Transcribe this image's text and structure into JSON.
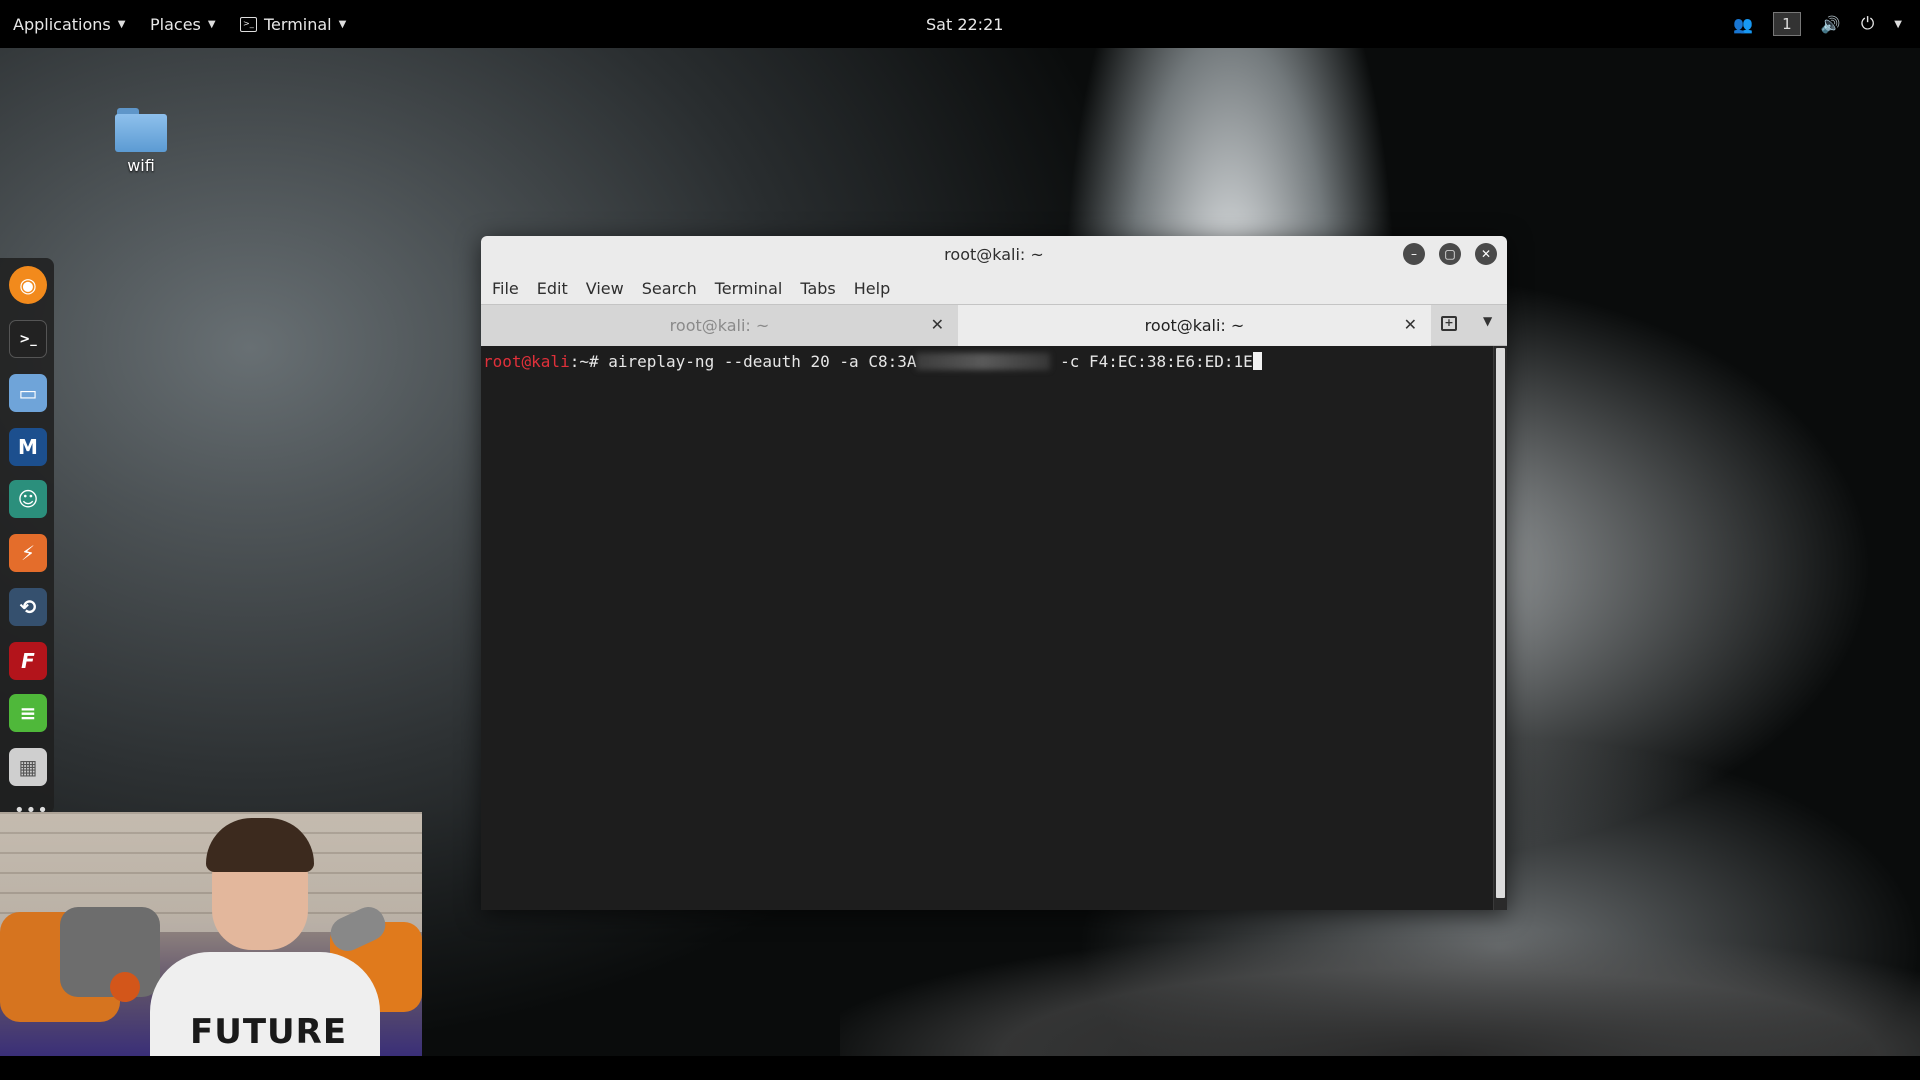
{
  "topbar": {
    "applications_label": "Applications",
    "places_label": "Places",
    "terminal_label": "Terminal",
    "clock": "Sat 22:21",
    "workspace": "1"
  },
  "desktop": {
    "folder_label": "wifi"
  },
  "dock": {
    "items": [
      "firefox-icon",
      "terminal-icon",
      "files-icon",
      "metasploit-icon",
      "armitage-icon",
      "burpsuite-icon",
      "maltego-icon",
      "faraday-icon",
      "leafpad-icon",
      "cherrytree-icon"
    ]
  },
  "window": {
    "title": "root@kali: ~",
    "menu": [
      "File",
      "Edit",
      "View",
      "Search",
      "Terminal",
      "Tabs",
      "Help"
    ],
    "tabs": [
      {
        "label": "root@kali: ~",
        "active": false
      },
      {
        "label": "root@kali: ~",
        "active": true
      }
    ]
  },
  "terminal": {
    "prompt_user": "root@kali",
    "prompt_rest": ":~# ",
    "command_part1": "aireplay-ng --deauth 20 -a C8:3A",
    "command_part2": " -c F4:EC:38:E6:ED:1E"
  },
  "webcam": {
    "shirt_text": "FUTURE"
  },
  "colors": {
    "prompt_red": "#e0303a",
    "terminal_bg": "#1d1d1d",
    "titlebar_bg": "#ebebeb"
  }
}
